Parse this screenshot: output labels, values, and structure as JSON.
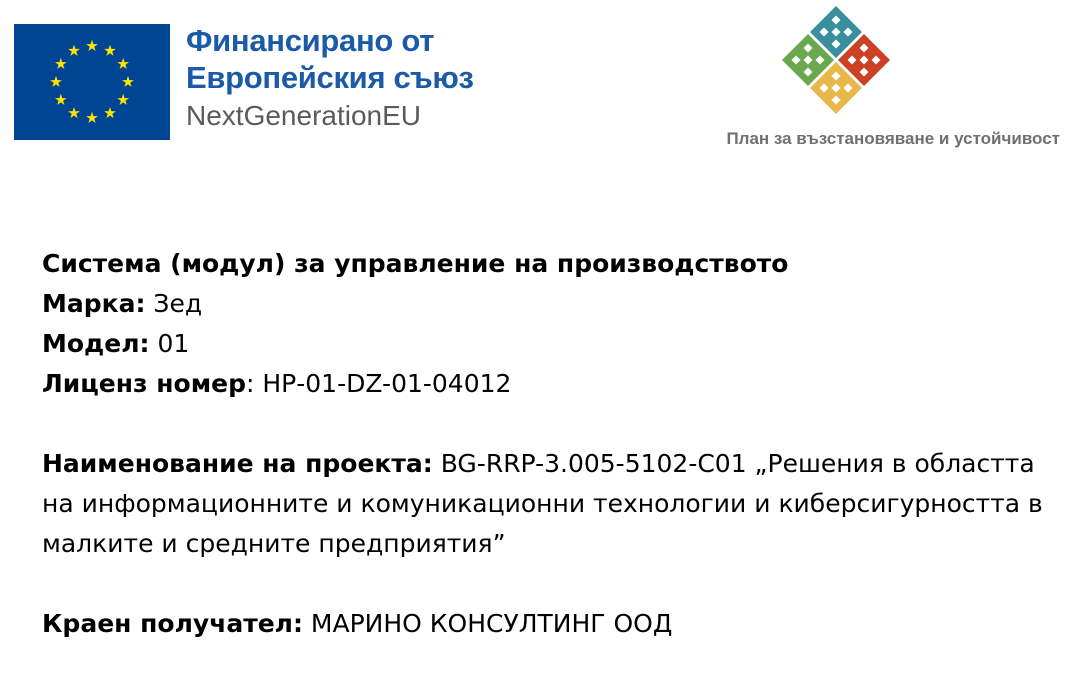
{
  "colors": {
    "eu_blue": "#004494",
    "eu_star": "#ffe400",
    "eu_text_blue": "#1a5aa8",
    "eu_text_grey": "#5a5a5a",
    "rrp_teal": "#3a8f9c",
    "rrp_green": "#6aa84f",
    "rrp_red": "#cc4125",
    "rrp_yellow": "#e8b84a",
    "caption_grey": "#707070"
  },
  "header": {
    "eu_line1": "Финансирано от",
    "eu_line2": "Европейския съюз",
    "eu_line3": "NextGenerationEU",
    "eu_flag_icon": "eu-flag-icon",
    "rrp_logo_icon": "rrp-pattern-icon",
    "rrp_caption": "План за възстановяване и устойчивост"
  },
  "info": {
    "system_title": "Система (модул) за управление на производството",
    "brand_label": "Марка:",
    "brand_value": " Зед",
    "model_label": "Модел:",
    "model_value": " 01",
    "license_label": "Лиценз номер",
    "license_value": ": НР-01-DZ-01-04012",
    "project_label": "Наименование на проекта:",
    "project_value": " BG-RRP-3.005-5102-C01 „Решения в областта на информационните и комуникационни технологии и киберсигурността в малките и средните предприятия”",
    "recipient_label": "Краен получател:",
    "recipient_value": " МАРИНО КОНСУЛТИНГ ООД"
  }
}
